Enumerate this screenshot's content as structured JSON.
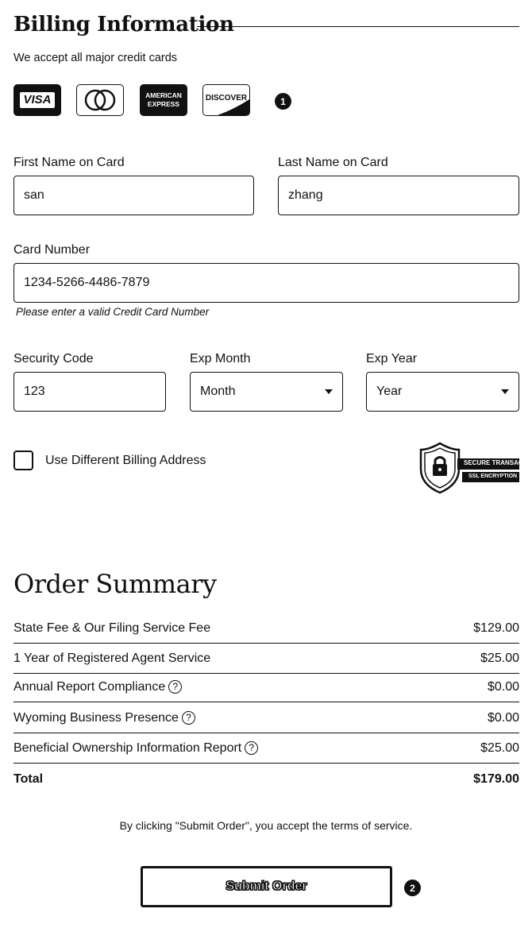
{
  "billing": {
    "title": "Billing Information",
    "subtitle": "We accept all major credit cards",
    "cards": {
      "visa": "VISA",
      "amex_line1": "AMERICAN",
      "amex_line2": "EXPRESS",
      "discover": "DISCOVER"
    },
    "marker_1": "1",
    "first_name": {
      "label": "First Name on Card",
      "value": "san"
    },
    "last_name": {
      "label": "Last Name on Card",
      "value": "zhang"
    },
    "card_number": {
      "label": "Card Number",
      "value": "1234-5266-4486-7879",
      "hint": "Please enter a valid Credit Card Number"
    },
    "security_code": {
      "label": "Security Code",
      "value": "123"
    },
    "exp_month": {
      "label": "Exp Month",
      "selected": "Month"
    },
    "exp_year": {
      "label": "Exp Year",
      "selected": "Year"
    },
    "different_address_label": "Use Different Billing Address",
    "secure_badge": {
      "line1": "SECURE TRANSACTION",
      "line2": "SSL ENCRYPTION"
    }
  },
  "summary": {
    "title": "Order Summary",
    "help_glyph": "?",
    "rows": [
      {
        "label": "State Fee & Our Filing Service Fee",
        "amount": "$129.00"
      },
      {
        "label": "1 Year of Registered Agent Service",
        "amount": "$25.00"
      },
      {
        "label": "Annual Report Compliance",
        "amount": "$0.00"
      },
      {
        "label": "Wyoming Business Presence",
        "amount": "$0.00"
      },
      {
        "label": "Beneficial Ownership Information Report",
        "amount": "$25.00"
      }
    ],
    "total": {
      "label": "Total",
      "amount": "$179.00"
    },
    "terms": "By clicking \"Submit Order\", you accept the terms of service.",
    "submit_label": "Submit Order",
    "marker_2": "2"
  }
}
